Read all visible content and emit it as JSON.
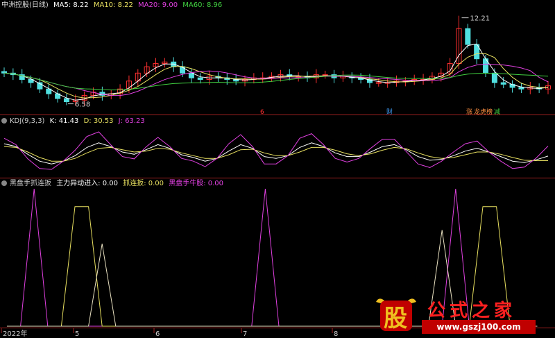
{
  "main": {
    "title": "中洲控股(日线)",
    "ma5": "MA5: 8.22",
    "ma10": "MA10: 8.22",
    "ma20": "MA20: 9.00",
    "ma60": "MA60: 8.96",
    "high_label": "12.21",
    "low_label": "6.58",
    "markers": [
      "6",
      "财",
      "涨",
      "龙虎榜",
      "减"
    ]
  },
  "kdj": {
    "title": "KDJ(9,3,3)",
    "k": "K: 41.43",
    "d": "D: 30.53",
    "j": "J: 63.23"
  },
  "ind": {
    "title": "黑盘手抓连扳",
    "a": "主力异动进入: 0.00",
    "b": "抓连扳: 0.00",
    "c": "黑盘手牛股: 0.00"
  },
  "xaxis": {
    "labels": [
      "2022年",
      "5",
      "6",
      "7",
      "8"
    ]
  },
  "watermark": {
    "logo": "股",
    "name": "公式之家",
    "url": "www.gszj100.com"
  },
  "colors": {
    "up": "#ff3030",
    "down": "#50e0e0",
    "ma5": "#ffffff",
    "ma10": "#e8e060",
    "ma20": "#e040e0",
    "ma60": "#40d040",
    "k": "#ffffff",
    "d": "#e8e060",
    "j": "#e040e0",
    "separator": "#a02020"
  },
  "chart_data": [
    {
      "type": "candlestick",
      "title": "中洲控股(日线)",
      "x_labels": [
        "2022年",
        "5",
        "6",
        "7",
        "8"
      ],
      "annotations": [
        {
          "text": "12.21",
          "kind": "high"
        },
        {
          "text": "6.58",
          "kind": "low"
        }
      ],
      "close": [
        8.6,
        8.5,
        8.2,
        8.0,
        7.6,
        7.3,
        7.0,
        6.8,
        6.9,
        7.2,
        7.4,
        7.2,
        7.3,
        7.6,
        8.1,
        8.6,
        9.0,
        9.2,
        9.3,
        9.0,
        8.6,
        8.3,
        8.2,
        8.4,
        8.3,
        8.2,
        8.1,
        8.2,
        8.3,
        8.3,
        8.4,
        8.5,
        8.4,
        8.4,
        8.3,
        8.5,
        8.5,
        8.3,
        8.4,
        8.3,
        8.2,
        8.0,
        8.0,
        8.0,
        8.1,
        8.1,
        8.2,
        8.2,
        8.4,
        8.6,
        9.2,
        11.4,
        10.4,
        9.5,
        8.6,
        8.0,
        7.9,
        7.7,
        7.6,
        7.7,
        7.6,
        7.8
      ],
      "ma5_last": 8.22,
      "ma10_last": 8.22,
      "ma20_last": 9.0,
      "ma60_last": 8.96
    },
    {
      "type": "line",
      "title": "KDJ(9,3,3)",
      "series": [
        {
          "name": "K",
          "values": [
            68,
            62,
            45,
            30,
            24,
            30,
            42,
            60,
            70,
            62,
            50,
            45,
            55,
            66,
            58,
            44,
            38,
            30,
            36,
            52,
            66,
            58,
            40,
            36,
            42,
            60,
            70,
            62,
            48,
            40,
            40,
            50,
            62,
            66,
            55,
            40,
            32,
            34,
            42,
            52,
            58,
            50,
            40,
            30,
            27,
            33,
            41
          ]
        },
        {
          "name": "D",
          "values": [
            62,
            60,
            50,
            38,
            30,
            30,
            36,
            48,
            58,
            60,
            55,
            50,
            52,
            58,
            56,
            48,
            42,
            36,
            36,
            44,
            55,
            56,
            48,
            42,
            42,
            50,
            60,
            60,
            54,
            46,
            42,
            46,
            54,
            60,
            57,
            48,
            40,
            36,
            38,
            44,
            50,
            50,
            45,
            38,
            32,
            31,
            31
          ]
        },
        {
          "name": "J",
          "values": [
            80,
            66,
            35,
            14,
            12,
            30,
            54,
            84,
            94,
            66,
            40,
            35,
            61,
            82,
            62,
            36,
            30,
            18,
            36,
            68,
            88,
            62,
            24,
            24,
            42,
            80,
            90,
            66,
            36,
            28,
            36,
            58,
            78,
            78,
            51,
            24,
            16,
            30,
            50,
            68,
            74,
            50,
            30,
            14,
            17,
            37,
            63
          ]
        }
      ]
    },
    {
      "type": "line",
      "title": "黑盘手抓连扳",
      "series": [
        {
          "name": "主力异动进入",
          "values": [
            0,
            0,
            1,
            0,
            0,
            0,
            0,
            0,
            0,
            0,
            0,
            0,
            0,
            0,
            0,
            0,
            0,
            0,
            0,
            1,
            0,
            0,
            0,
            0,
            0,
            0,
            0,
            0,
            0,
            0,
            0,
            0,
            0,
            1,
            0,
            0,
            0,
            0,
            0,
            0
          ]
        },
        {
          "name": "抓连扳",
          "values": [
            0,
            0,
            0,
            0,
            0,
            0.87,
            0.87,
            0,
            0,
            0,
            0,
            0,
            0,
            0,
            0,
            0,
            0,
            0,
            0,
            0,
            0,
            0,
            0,
            0,
            0,
            0,
            0,
            0,
            0,
            0,
            0,
            0,
            0,
            0,
            0,
            0.87,
            0.87,
            0,
            0,
            0
          ]
        },
        {
          "name": "黑盘手牛股",
          "values": [
            0,
            0,
            0,
            0,
            0,
            0,
            0,
            0.6,
            0,
            0,
            0,
            0,
            0,
            0,
            0,
            0,
            0,
            0,
            0,
            0,
            0,
            0,
            0,
            0,
            0,
            0,
            0,
            0,
            0,
            0,
            0,
            0,
            0.7,
            0,
            0,
            0,
            0,
            0,
            0,
            0
          ]
        }
      ]
    }
  ]
}
